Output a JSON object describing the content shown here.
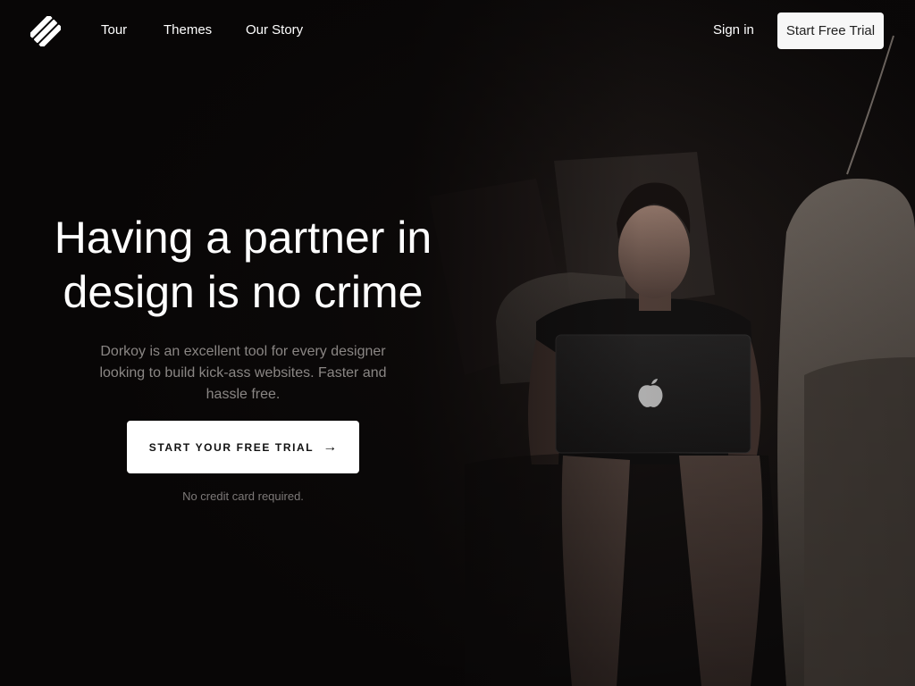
{
  "nav": {
    "logo_icon": "stripes-logo-icon",
    "links": [
      "Tour",
      "Themes",
      "Our Story"
    ],
    "sign_in": "Sign in",
    "trial_button": "Start Free Trial"
  },
  "hero": {
    "headline": "Having a partner in design is no crime",
    "subtext": "Dorkoy is an excellent tool for every designer looking to build kick-ass websites. Faster and hassle free.",
    "cta_label": "START YOUR FREE TRIAL",
    "cta_arrow": "→",
    "note": "No credit card required."
  },
  "colors": {
    "background": "#0a0808",
    "text": "#ffffff",
    "muted_text": "#8a8684",
    "button_bg": "#f7f7f7"
  }
}
